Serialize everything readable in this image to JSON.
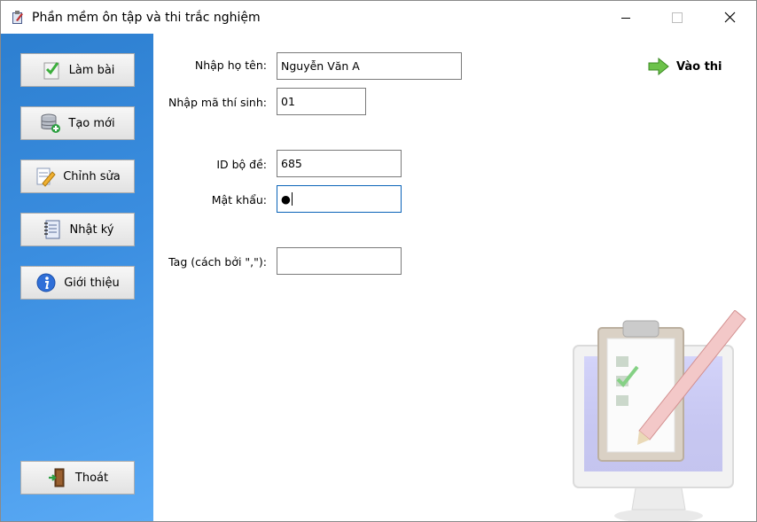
{
  "window": {
    "title": "Phần mềm ôn tập và thi trắc nghiệm",
    "controls": {
      "minimize": "minimize",
      "maximize": "maximize",
      "close": "close"
    }
  },
  "sidebar": {
    "items": [
      {
        "label": "Làm bài",
        "icon": "checkmark-doc-icon"
      },
      {
        "label": "Tạo mới",
        "icon": "database-add-icon"
      },
      {
        "label": "Chỉnh sửa",
        "icon": "edit-doc-icon"
      },
      {
        "label": "Nhật ký",
        "icon": "notebook-icon"
      },
      {
        "label": "Giới thiệu",
        "icon": "info-icon"
      }
    ],
    "exit": {
      "label": "Thoát",
      "icon": "exit-door-icon"
    }
  },
  "form": {
    "name": {
      "label": "Nhập họ tên:",
      "value": "Nguyễn Văn A"
    },
    "candidate_id": {
      "label": "Nhập mã thí sinh:",
      "value": "01"
    },
    "set_id": {
      "label": "ID bộ đề:",
      "value": "685"
    },
    "password": {
      "label": "Mật khẩu:",
      "value": "●"
    },
    "tags": {
      "label": "Tag (cách bởi \",\"):",
      "value": ""
    }
  },
  "actions": {
    "start": {
      "label": "Vào thi",
      "icon": "arrow-right-icon"
    }
  },
  "colors": {
    "sidebar_top": "#2d7fd0",
    "sidebar_bottom": "#5aaaf5",
    "focus_border": "#0a63b8"
  }
}
